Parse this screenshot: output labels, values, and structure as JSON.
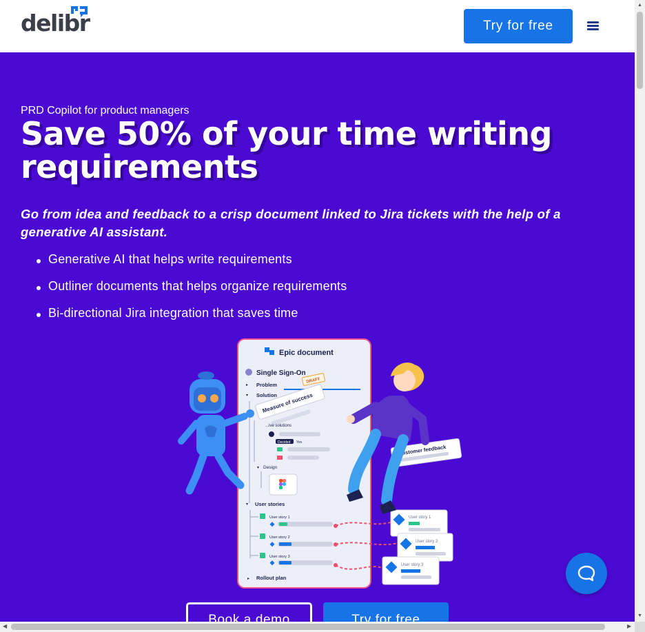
{
  "header": {
    "logo_text": "delibr",
    "cta_label": "Try for free",
    "menu_icon": "hamburger-menu-icon"
  },
  "hero": {
    "eyebrow": "PRD Copilot for product managers",
    "headline": "Save 50% of your time writing requirements",
    "subhead": "Go from idea and feedback to a crisp document linked to Jira tickets with the help of a generative AI assistant.",
    "bullets": [
      "Generative AI that helps write requirements",
      "Outliner documents that helps organize requirements",
      "Bi-directional Jira integration that saves time"
    ],
    "illustration": {
      "doc_title": "Epic document",
      "section": "Single Sign-On",
      "problem": "Problem",
      "solution": "Solution",
      "measure": "Measure of success",
      "draft_badge": "DRAFT",
      "alt_solutions": "...ive solutions",
      "decided": "Decided",
      "yes": "Yes",
      "design": "Design",
      "user_stories": "User stories",
      "story1": "User story 1",
      "story2": "User story 2",
      "story3": "User story 3",
      "rollout": "Rollout plan",
      "feedback": "Customer feedback",
      "jira1": "User story 1",
      "jira2": "User story 2",
      "jira3": "User story 3"
    },
    "book_demo_label": "Book a demo",
    "try_label": "Try for free"
  },
  "chat": {
    "icon": "chat-bubble-icon"
  },
  "colors": {
    "hero_bg": "#4a0ad3",
    "accent": "#1774e6",
    "logo_mark": "#1774e6"
  }
}
